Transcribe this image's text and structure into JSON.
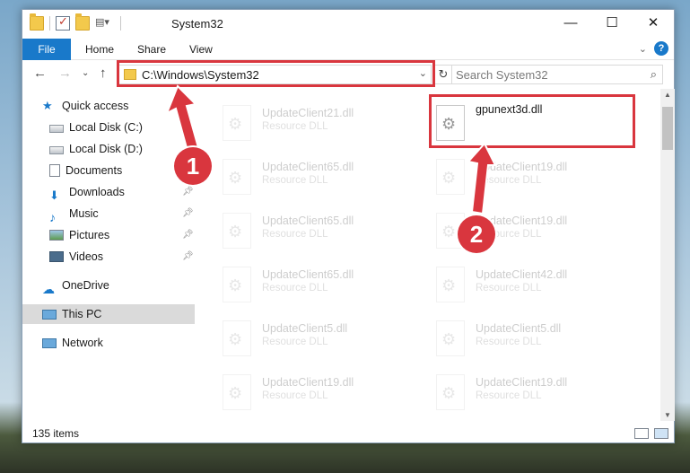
{
  "window": {
    "title": "System32"
  },
  "ribbon": {
    "file_label": "File",
    "tabs": [
      "Home",
      "Share",
      "View"
    ]
  },
  "address": {
    "path": "C:\\Windows\\System32",
    "search_placeholder": "Search System32"
  },
  "sidebar": {
    "items": [
      {
        "label": "Quick access",
        "icon": "star-icon"
      },
      {
        "label": "Local Disk (C:)",
        "icon": "disk-icon"
      },
      {
        "label": "Local Disk (D:)",
        "icon": "disk-icon"
      },
      {
        "label": "Documents",
        "icon": "documents-icon"
      },
      {
        "label": "Downloads",
        "icon": "downloads-icon"
      },
      {
        "label": "Music",
        "icon": "music-icon"
      },
      {
        "label": "Pictures",
        "icon": "pictures-icon"
      },
      {
        "label": "Videos",
        "icon": "videos-icon"
      },
      {
        "label": "OneDrive",
        "icon": "cloud-icon"
      },
      {
        "label": "This PC",
        "icon": "computer-icon"
      },
      {
        "label": "Network",
        "icon": "network-icon"
      }
    ]
  },
  "files": [
    {
      "name": "UpdateClient21.dll",
      "type": "Resource DLL"
    },
    {
      "name": "gpunext3d.dll",
      "type": ""
    },
    {
      "name": "UpdateClient65.dll",
      "type": "Resource DLL"
    },
    {
      "name": "UpdateClient19.dll",
      "type": "Resource DLL"
    },
    {
      "name": "UpdateClient65.dll",
      "type": "Resource DLL"
    },
    {
      "name": "UpdateClient19.dll",
      "type": "Resource DLL"
    },
    {
      "name": "UpdateClient65.dll",
      "type": "Resource DLL"
    },
    {
      "name": "UpdateClient42.dll",
      "type": "Resource DLL"
    },
    {
      "name": "UpdateClient5.dll",
      "type": "Resource DLL"
    },
    {
      "name": "UpdateClient5.dll",
      "type": "Resource DLL"
    },
    {
      "name": "UpdateClient19.dll",
      "type": "Resource DLL"
    },
    {
      "name": "UpdateClient19.dll",
      "type": "Resource DLL"
    }
  ],
  "status": {
    "item_count": "135 items"
  },
  "annotations": {
    "step1": "1",
    "step2": "2",
    "color": "#d9363e"
  }
}
